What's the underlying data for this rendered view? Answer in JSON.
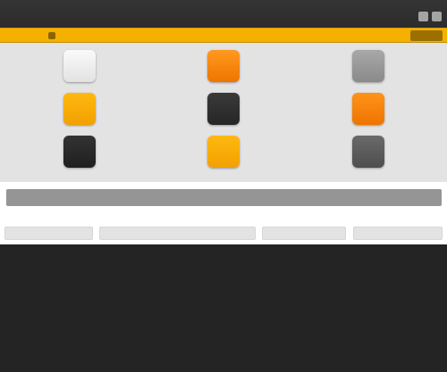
{
  "colors": {
    "titlebar": "#303030",
    "toolbar_accent": "#f5b000",
    "panel_bg": "#e3e3e3",
    "form_bg": "#ffffff",
    "input_bar": "#959595",
    "background": "#242424"
  },
  "swatches": [
    {
      "name": "white",
      "color_top": "#fafafa",
      "color_bottom": "#e2e2e2"
    },
    {
      "name": "orange",
      "color_top": "#ff9a1f",
      "color_bottom": "#ee7400"
    },
    {
      "name": "gray",
      "color_top": "#a8a8a8",
      "color_bottom": "#8a8a8a"
    },
    {
      "name": "amber",
      "color_top": "#ffb810",
      "color_bottom": "#f2a100"
    },
    {
      "name": "black",
      "color_top": "#3a3a3a",
      "color_bottom": "#262626"
    },
    {
      "name": "orange",
      "color_top": "#ff931a",
      "color_bottom": "#ee7400"
    },
    {
      "name": "black",
      "color_top": "#333333",
      "color_bottom": "#1f1f1f"
    },
    {
      "name": "amber",
      "color_top": "#ffb810",
      "color_bottom": "#f2a100"
    },
    {
      "name": "dark-gray",
      "color_top": "#6a6a6a",
      "color_bottom": "#4e4e4e"
    }
  ]
}
